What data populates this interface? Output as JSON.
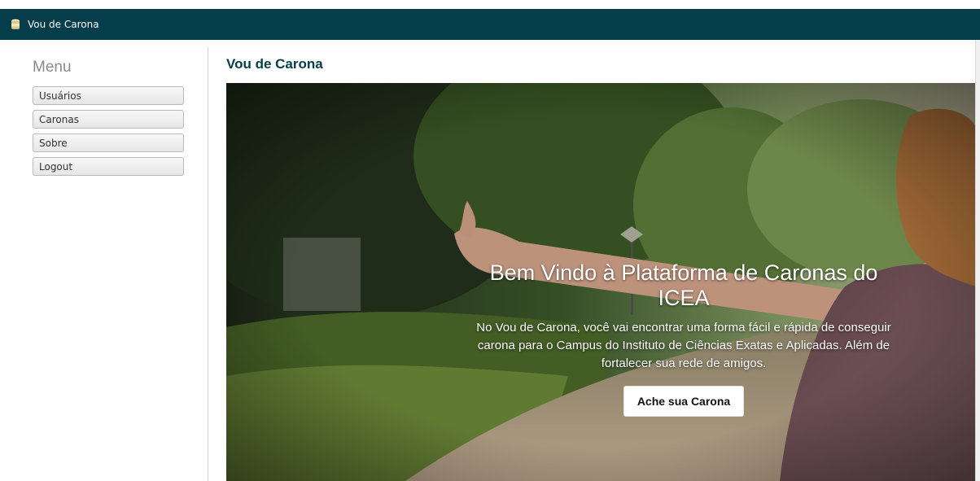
{
  "navbar": {
    "brand_label": "Vou de Carona",
    "brand_icon": "database-icon",
    "background": "#063d4a"
  },
  "sidebar": {
    "title": "Menu",
    "items": [
      {
        "label": "Usuários"
      },
      {
        "label": "Caronas"
      },
      {
        "label": "Sobre"
      },
      {
        "label": "Logout"
      }
    ]
  },
  "main": {
    "title": "Vou de Carona",
    "title_color": "#063d4a",
    "hero": {
      "heading": "Bem Vindo à Plataforma de Caronas do ICEA",
      "subtitle": "No Vou de Carona, você vai encontrar uma forma fácil e rápida de conseguir carona para o Campus do Instituto de Ciências Exatas e Aplicadas. Além de fortalecer sua rede de amigos.",
      "button_label": "Ache sua Carona"
    }
  }
}
